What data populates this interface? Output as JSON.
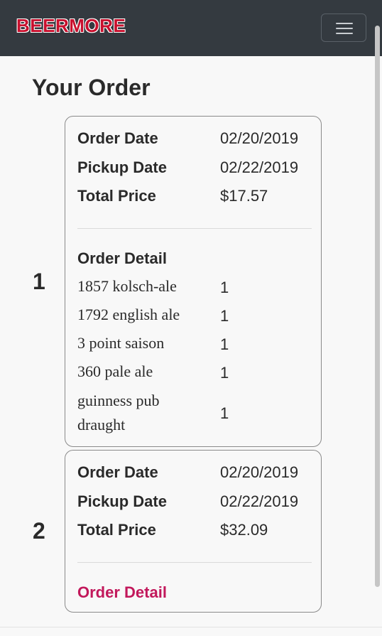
{
  "navbar": {
    "brand": "BEERMORE",
    "menu_icon": "hamburger-icon"
  },
  "page": {
    "title": "Your Order"
  },
  "labels": {
    "order_date": "Order Date",
    "pickup_date": "Pickup Date",
    "total_price": "Total Price",
    "order_detail": "Order Detail"
  },
  "orders": [
    {
      "number": "1",
      "order_date": "02/20/2019",
      "pickup_date": "02/22/2019",
      "total_price": "$17.57",
      "items": [
        {
          "name": "1857 kolsch-ale",
          "qty": "1"
        },
        {
          "name": "1792 english ale",
          "qty": "1"
        },
        {
          "name": "3 point saison",
          "qty": "1"
        },
        {
          "name": "360 pale ale",
          "qty": "1"
        },
        {
          "name_line1": "guinness pub",
          "name_line2": "draught",
          "qty": "1"
        }
      ]
    },
    {
      "number": "2",
      "order_date": "02/20/2019",
      "pickup_date": "02/22/2019",
      "total_price": "$32.09"
    }
  ],
  "colors": {
    "brand": "#c8102e",
    "link": "#c2185b",
    "navbar": "#343a40"
  }
}
